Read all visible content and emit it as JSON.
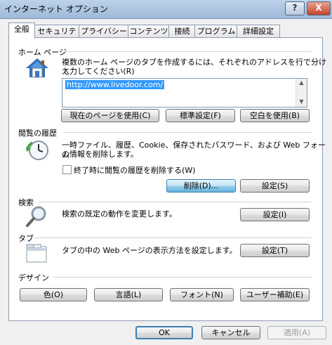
{
  "window": {
    "title": "インターネット オプション",
    "help": "?",
    "close": "X"
  },
  "tabs": [
    "全般",
    "セキュリティ",
    "プライバシー",
    "コンテンツ",
    "接続",
    "プログラム",
    "詳細設定"
  ],
  "home": {
    "label": "ホーム ページ",
    "desc1": "複数のホーム ページのタブを作成するには、それぞれのアドレスを行で分けて",
    "desc2": "入力してください(R)",
    "url": "http://www.livedoor.com/",
    "btn_current": "現在のページを使用(C)",
    "btn_default": "標準設定(F)",
    "btn_blank": "空白を使用(B)"
  },
  "history": {
    "label": "閲覧の履歴",
    "desc1": "一時ファイル、履歴、Cookie、保存されたパスワード、および Web フォーム",
    "desc2": "の情報を削除します。",
    "checkbox_label": "終了時に閲覧の履歴を削除する(W)",
    "checkbox_checked": false,
    "btn_delete": "削除(D)...",
    "btn_settings": "設定(S)"
  },
  "search": {
    "label": "検索",
    "desc": "検索の既定の動作を変更します。",
    "btn_settings": "設定(I)"
  },
  "tabs_section": {
    "label": "タブ",
    "desc": "タブの中の Web ページの表示方法を設定します。",
    "btn_settings": "設定(T)"
  },
  "design": {
    "label": "デザイン",
    "btn_colors": "色(O)",
    "btn_languages": "言語(L)",
    "btn_fonts": "フォント(N)",
    "btn_accessibility": "ユーザー補助(E)"
  },
  "footer": {
    "ok": "OK",
    "cancel": "キャンセル",
    "apply": "適用(A)"
  },
  "icons": {
    "home": "house-icon",
    "history": "history-clock-icon",
    "search": "magnifier-icon",
    "tabs": "tabs-window-icon"
  },
  "colors": {
    "selection": "#3399ff",
    "focus_border": "#3c7fb1"
  }
}
